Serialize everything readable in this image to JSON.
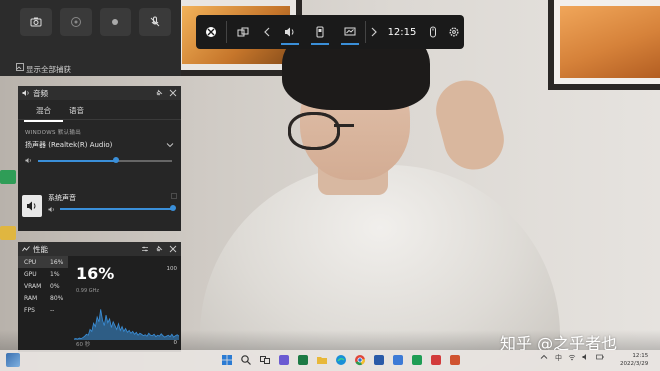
{
  "capture": {
    "buttons": [
      {
        "name": "screenshot-icon"
      },
      {
        "name": "record-last-icon"
      },
      {
        "name": "record-icon"
      },
      {
        "name": "mic-muted-icon"
      }
    ],
    "show_all_label": "显示全部捕获"
  },
  "gamebar": {
    "time": "12:15",
    "buttons": [
      "xbox-icon",
      "widget-menu-icon",
      "chevron-left-icon",
      "audio-icon",
      "capture-icon",
      "performance-icon",
      "chevron-right-icon",
      "mouse-icon",
      "settings-icon"
    ]
  },
  "audio": {
    "title": "音频",
    "tabs": [
      "混合",
      "语音"
    ],
    "active_tab": 0,
    "output_label": "WINDOWS 默认输出",
    "device": "扬声器 (Realtek(R) Audio)",
    "device_volume": 0.58,
    "app_name": "系统声音",
    "app_volume": 1.0
  },
  "performance": {
    "title": "性能",
    "metrics": [
      {
        "key": "CPU",
        "value": "16%"
      },
      {
        "key": "GPU",
        "value": "1%"
      },
      {
        "key": "VRAM",
        "value": "0%"
      },
      {
        "key": "RAM",
        "value": "80%"
      },
      {
        "key": "FPS",
        "value": "--"
      }
    ],
    "selected_metric": 0,
    "big_value": "16%",
    "sub_value": "0.99 GHz",
    "max_label": "100",
    "min_label": "0",
    "span_label": "60 秒",
    "chart_data": {
      "type": "area",
      "ylim": [
        0,
        100
      ],
      "values": [
        2,
        3,
        2,
        4,
        3,
        5,
        8,
        12,
        10,
        22,
        18,
        35,
        28,
        48,
        38,
        64,
        42,
        30,
        52,
        36,
        44,
        26,
        38,
        30,
        22,
        34,
        20,
        28,
        18,
        24,
        16,
        20,
        14,
        18,
        12,
        16,
        10,
        14,
        12,
        9,
        11,
        8,
        14,
        10,
        9,
        12,
        7,
        10,
        8,
        13,
        9,
        6,
        8,
        10,
        7,
        12,
        6,
        9,
        11,
        8
      ]
    }
  },
  "watermark": "知乎 @之乎者也",
  "taskbar": {
    "apps": [
      "windows-start-icon",
      "search-icon",
      "task-view-icon",
      "chat-icon",
      "excel-icon",
      "file-explorer-icon",
      "edge-icon",
      "chrome-icon",
      "word-icon",
      "store-icon",
      "spreadsheet-icon",
      "wps-icon",
      "powerpoint-icon"
    ],
    "clock_time": "12:15",
    "clock_date": "2022/3/29"
  },
  "colors": {
    "accent": "#3a8fd9",
    "panel_bg": "#262626",
    "gamebar_bg": "#1a1a1a"
  }
}
